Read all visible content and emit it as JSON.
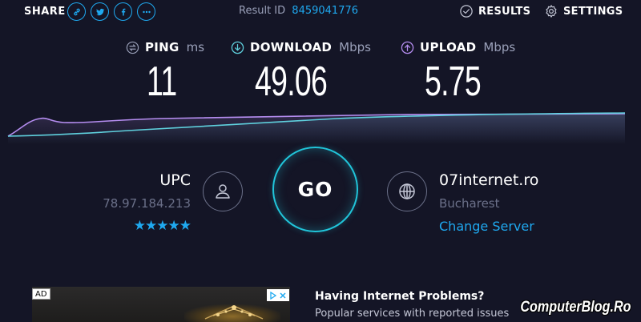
{
  "header": {
    "share_label": "SHARE",
    "share_icons": [
      "link-icon",
      "twitter-icon",
      "facebook-icon",
      "more-icon"
    ],
    "result_id_label": "Result ID",
    "result_id_value": "8459041776",
    "results_label": "RESULTS",
    "settings_label": "SETTINGS"
  },
  "metrics": {
    "ping": {
      "name": "PING",
      "unit": "ms",
      "value": "11"
    },
    "download": {
      "name": "DOWNLOAD",
      "unit": "Mbps",
      "value": "49.06"
    },
    "upload": {
      "name": "UPLOAD",
      "unit": "Mbps",
      "value": "5.75"
    }
  },
  "colors": {
    "background": "#141526",
    "accent_blue": "#1fa9f0",
    "go_ring": "#21c5da",
    "download_line": "#5fd0dd",
    "upload_line": "#b58df0",
    "muted_text": "#6b7089"
  },
  "isp": {
    "name": "UPC",
    "ip": "78.97.184.213",
    "stars": "★★★★★",
    "rating": 5
  },
  "go_label": "GO",
  "server": {
    "name": "07internet.ro",
    "city": "Bucharest",
    "change_label": "Change Server"
  },
  "ad": {
    "badge": "AD",
    "title": "Having Internet Problems?",
    "description": "Popular services with reported issues"
  },
  "watermark": "ComputerBlog.Ro"
}
